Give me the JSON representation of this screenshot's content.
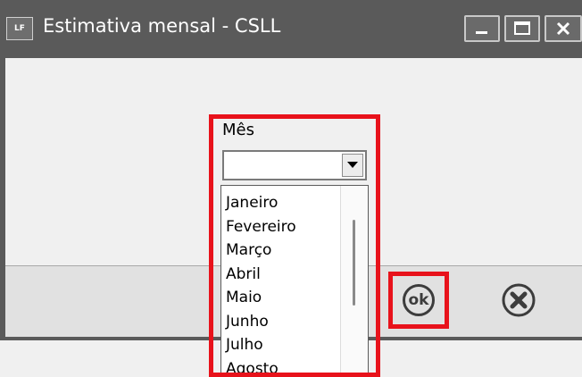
{
  "window": {
    "title": "Estimativa mensal - CSLL",
    "logo_text": "LF",
    "buttons": [
      "minimize-icon",
      "maximize-icon",
      "close-icon"
    ]
  },
  "form": {
    "month_label": "Mês",
    "month_value": "",
    "month_options": [
      "Janeiro",
      "Fevereiro",
      "Março",
      "Abril",
      "Maio",
      "Junho",
      "Julho",
      "Agosto"
    ]
  },
  "actions": {
    "ok_label": "ok",
    "cancel_icon": "cancel-x-icon"
  },
  "colors": {
    "titlebar": "#5a5a5a",
    "highlight": "#e8121b",
    "background": "#f0f0f0"
  }
}
